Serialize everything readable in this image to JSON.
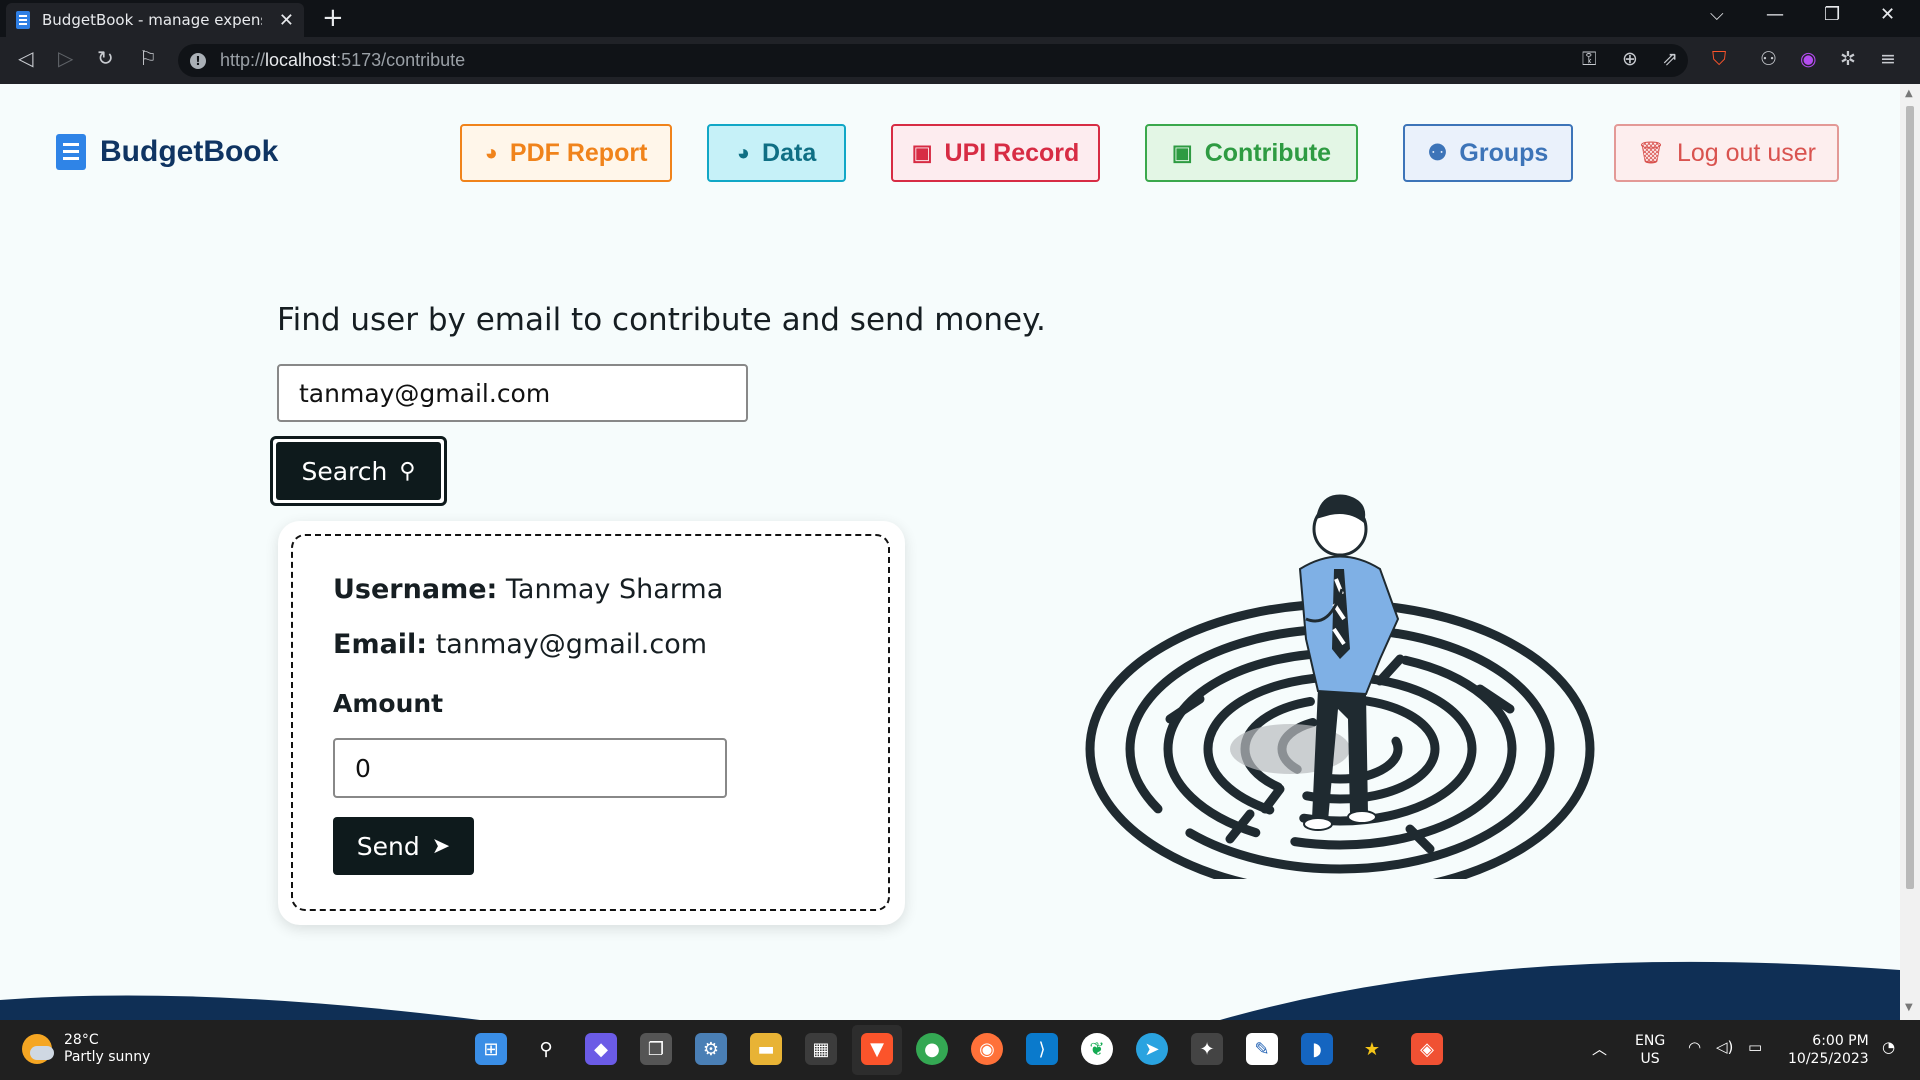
{
  "browser": {
    "tab_title": "BudgetBook - manage expenses",
    "tab_close": "✕",
    "new_tab": "+",
    "url_scheme": "http://",
    "url_host": "localhost",
    "url_path": ":5173/contribute",
    "controls": {
      "collapse": "⌵",
      "minimize": "—",
      "restore": "❐",
      "close": "✕"
    }
  },
  "header": {
    "brand": "BudgetBook",
    "nav": [
      {
        "label": "PDF Report",
        "icon": "pie-chart-icon"
      },
      {
        "label": "Data",
        "icon": "pie-chart-icon"
      },
      {
        "label": "UPI Record",
        "icon": "money-bill-icon"
      },
      {
        "label": "Contribute",
        "icon": "money-bill-icon"
      },
      {
        "label": "Groups",
        "icon": "users-icon"
      },
      {
        "label": "Log out user",
        "icon": "trash-icon"
      }
    ]
  },
  "search": {
    "heading": "Find user by email to contribute and send money.",
    "email_value": "tanmay@gmail.com",
    "button_label": "Search"
  },
  "result": {
    "username_label": "Username:",
    "username": "Tanmay Sharma",
    "email_label": "Email:",
    "email": "tanmay@gmail.com",
    "amount_label": "Amount",
    "amount_value": "0",
    "send_label": "Send"
  },
  "taskbar": {
    "weather_temp": "28°C",
    "weather_desc": "Partly sunny",
    "lang_top": "ENG",
    "lang_bottom": "US",
    "time": "6:00 PM",
    "date": "10/25/2023"
  },
  "colors": {
    "brand": "#0f3462",
    "pdf": "#f0831b",
    "data": "#11a7c6",
    "upi": "#d72c44",
    "contribute": "#2e9b42",
    "groups": "#3d74b8",
    "logout": "#d9534f",
    "dark": "#0e1a1c"
  }
}
